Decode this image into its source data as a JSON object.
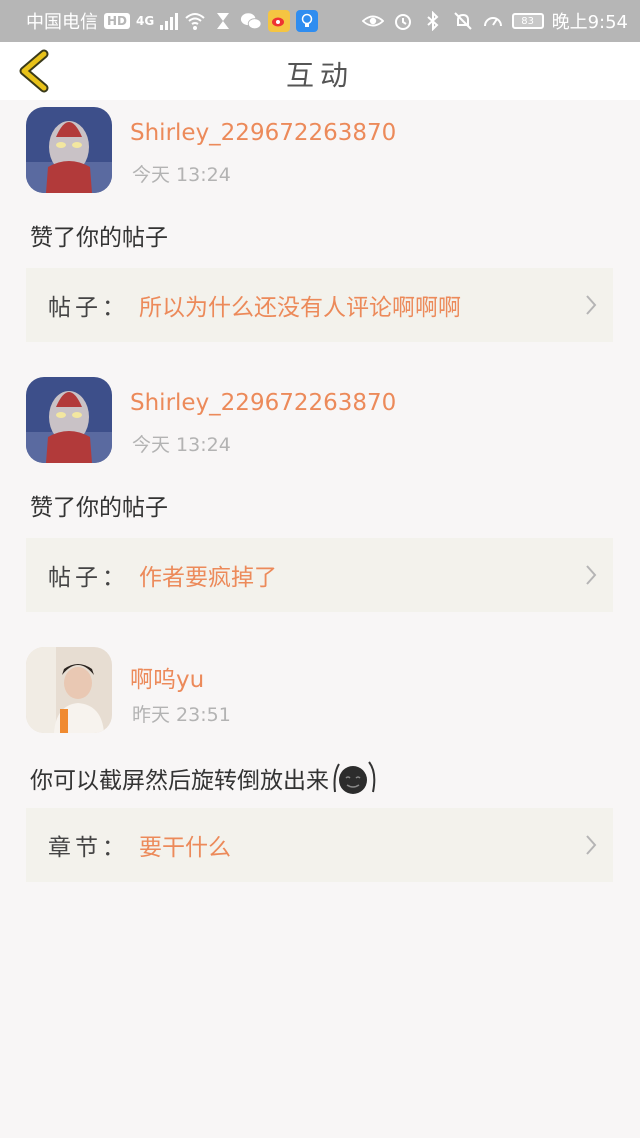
{
  "status_bar": {
    "carrier": "中国电信",
    "hd": "HD",
    "network": "4G",
    "battery": "83",
    "time": "晚上9:54"
  },
  "header": {
    "title": "互动"
  },
  "feed": [
    {
      "username": "Shirley_229672263870",
      "time": "今天 13:24",
      "action": "赞了你的帖子",
      "target_label": "帖子：",
      "target_value": "所以为什么还没有人评论啊啊啊"
    },
    {
      "username": "Shirley_229672263870",
      "time": "今天 13:24",
      "action": "赞了你的帖子",
      "target_label": "帖子：",
      "target_value": "作者要疯掉了"
    },
    {
      "username": "啊呜yu",
      "time": "昨天 23:51",
      "action": "你可以截屏然后旋转倒放出来",
      "target_label": "章节：",
      "target_value": "要干什么"
    }
  ],
  "colors": {
    "accent": "#ec8a5a",
    "back_arrow": "#e8c21a",
    "status_bar": "#b6b6b6",
    "card": "#f3f2ec"
  }
}
